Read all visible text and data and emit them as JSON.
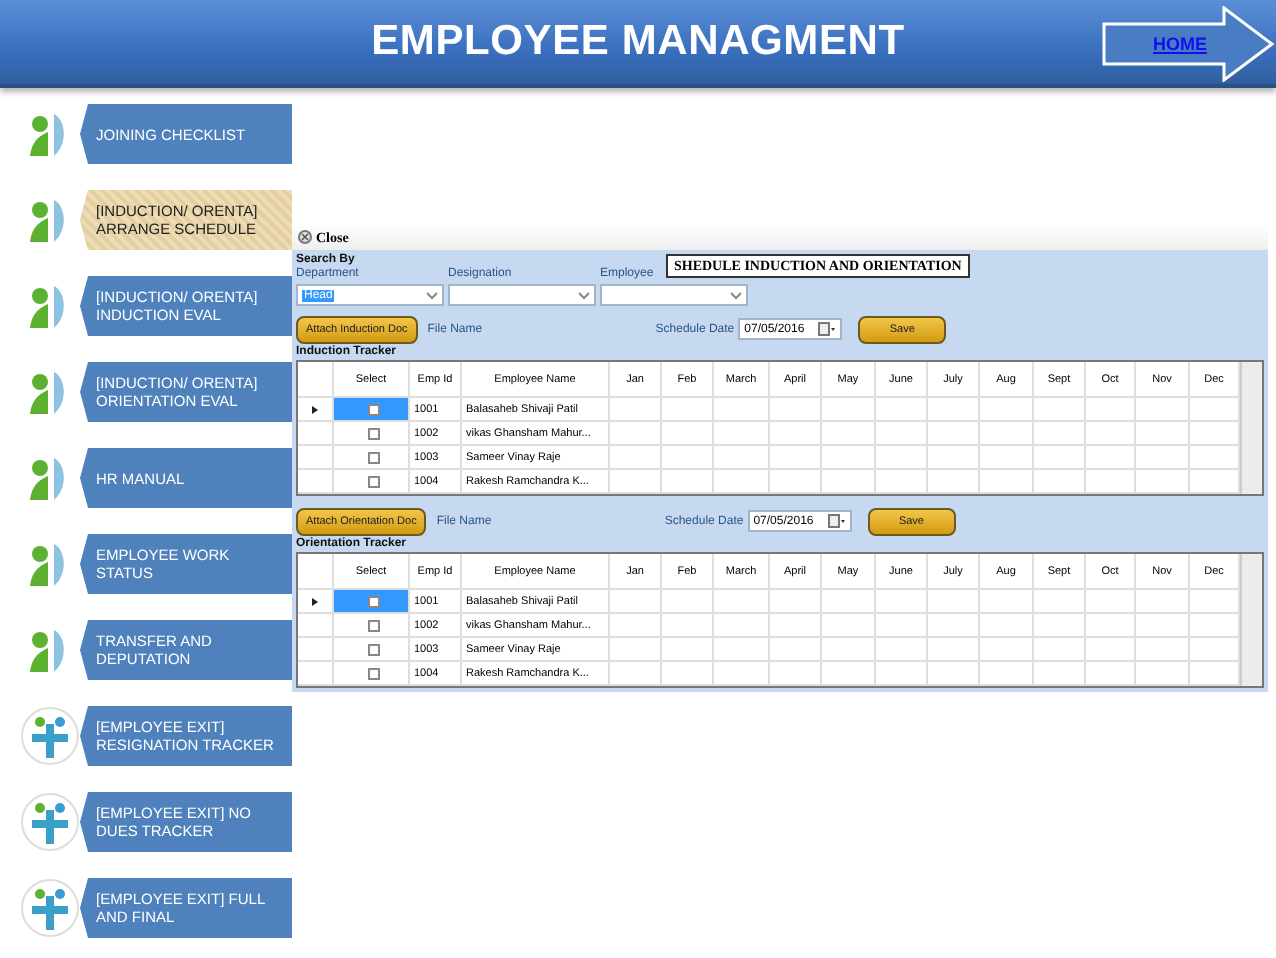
{
  "header": {
    "title": "EMPLOYEE MANAGMENT",
    "home_link": "HOME"
  },
  "sidebar": {
    "items": [
      {
        "label": "JOINING CHECKLIST",
        "kind": "figure",
        "selected": false
      },
      {
        "label": "[INDUCTION/ ORENTA] ARRANGE SCHEDULE",
        "kind": "figure",
        "selected": true
      },
      {
        "label": "[INDUCTION/ ORENTA] INDUCTION EVAL",
        "kind": "figure",
        "selected": false
      },
      {
        "label": "[INDUCTION/ ORENTA] ORIENTATION EVAL",
        "kind": "figure",
        "selected": false
      },
      {
        "label": "HR MANUAL",
        "kind": "figure",
        "selected": false
      },
      {
        "label": "EMPLOYEE WORK STATUS",
        "kind": "figure",
        "selected": false
      },
      {
        "label": "TRANSFER AND DEPUTATION",
        "kind": "figure",
        "selected": false
      },
      {
        "label": "[EMPLOYEE EXIT] RESIGNATION TRACKER",
        "kind": "cross",
        "selected": false
      },
      {
        "label": "[EMPLOYEE EXIT] NO DUES TRACKER",
        "kind": "cross",
        "selected": false
      },
      {
        "label": "[EMPLOYEE EXIT] FULL AND FINAL",
        "kind": "cross",
        "selected": false
      }
    ]
  },
  "form": {
    "close": "Close",
    "search_by": "Search By",
    "title": "SHEDULE INDUCTION AND ORIENTATION",
    "filters": [
      {
        "label": "Department",
        "value": "Head"
      },
      {
        "label": "Designation"
      },
      {
        "label": "Employee"
      }
    ],
    "sections": [
      {
        "attach_button": "Attach Induction Doc",
        "file_name_label": "File Name",
        "schedule_date_label": "Schedule Date",
        "schedule_date": "07/05/2016",
        "save_button": "Save",
        "tracker_title": "Induction Tracker",
        "columns": [
          "Select",
          "Emp Id",
          "Employee Name",
          "Jan",
          "Feb",
          "March",
          "April",
          "May",
          "June",
          "July",
          "Aug",
          "Sept",
          "Oct",
          "Nov",
          "Dec"
        ],
        "rows": [
          {
            "emp_id": "1001",
            "name": "Balasaheb  Shivaji Patil",
            "checked": false,
            "selected": true
          },
          {
            "emp_id": "1002",
            "name": "vikas Ghansham Mahur...",
            "checked": false,
            "selected": false
          },
          {
            "emp_id": "1003",
            "name": "Sameer Vinay Raje",
            "checked": false,
            "selected": false
          },
          {
            "emp_id": "1004",
            "name": "Rakesh Ramchandra K...",
            "checked": false,
            "selected": false
          }
        ]
      },
      {
        "attach_button": "Attach Orientation Doc",
        "file_name_label": "File Name",
        "schedule_date_label": "Schedule Date",
        "schedule_date": "07/05/2016",
        "save_button": "Save",
        "tracker_title": "Orientation Tracker",
        "columns": [
          "Select",
          "Emp Id",
          "Employee Name",
          "Jan",
          "Feb",
          "March",
          "April",
          "May",
          "June",
          "July",
          "Aug",
          "Sept",
          "Oct",
          "Nov",
          "Dec"
        ],
        "rows": [
          {
            "emp_id": "1001",
            "name": "Balasaheb  Shivaji Patil",
            "checked": false,
            "selected": true
          },
          {
            "emp_id": "1002",
            "name": "vikas Ghansham Mahur...",
            "checked": false,
            "selected": false
          },
          {
            "emp_id": "1003",
            "name": "Sameer Vinay Raje",
            "checked": false,
            "selected": false
          },
          {
            "emp_id": "1004",
            "name": "Rakesh Ramchandra K...",
            "checked": false,
            "selected": false
          }
        ]
      }
    ]
  }
}
